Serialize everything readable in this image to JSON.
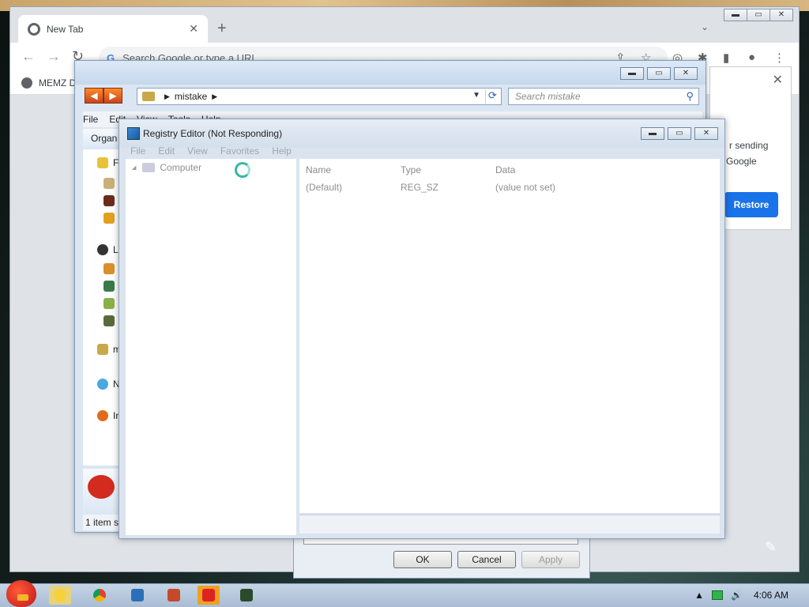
{
  "chrome": {
    "tab_title": "New Tab",
    "tab_close": "✕",
    "new_tab": "+",
    "tab_search": "⌄",
    "omnibox_g": "G",
    "omnibox_placeholder": "Search Google or type a URL",
    "bookmark": "MEMZ D",
    "window_controls": [
      "▬",
      "▭",
      "✕"
    ]
  },
  "restore_popup": {
    "close": "✕",
    "text_line1": "r sending",
    "text_line2": "Google",
    "button": "Restore"
  },
  "explorer": {
    "window_controls": [
      "▬",
      "▭",
      "✕"
    ],
    "nav_back": "◀",
    "nav_forward": "▶",
    "address_folder": "mistake",
    "search_placeholder": "Search mistake",
    "menu": [
      "File",
      "Edit",
      "View",
      "Tools",
      "Help"
    ],
    "command_bar": "Organ",
    "nav_items": [
      "F",
      "L",
      "m",
      "N",
      "In"
    ],
    "status": "1 item se"
  },
  "properties_dialog": {
    "ok": "OK",
    "cancel": "Cancel",
    "apply": "Apply"
  },
  "regedit": {
    "title": "Registry Editor (Not Responding)",
    "window_controls": [
      "▬",
      "▭",
      "✕"
    ],
    "menu": [
      "File",
      "Edit",
      "View",
      "Favorites",
      "Help"
    ],
    "tree_root": "Computer",
    "columns": {
      "name": "Name",
      "type": "Type",
      "data": "Data"
    },
    "rows": [
      {
        "name": "(Default)",
        "type": "REG_SZ",
        "data": "(value not set)"
      }
    ]
  },
  "taskbar": {
    "tray_up": "▲",
    "volume": "🔊",
    "clock": "4:06 AM"
  },
  "colors": {
    "accent_blue": "#1a73e8",
    "taskbar": "#b8c9dd"
  }
}
